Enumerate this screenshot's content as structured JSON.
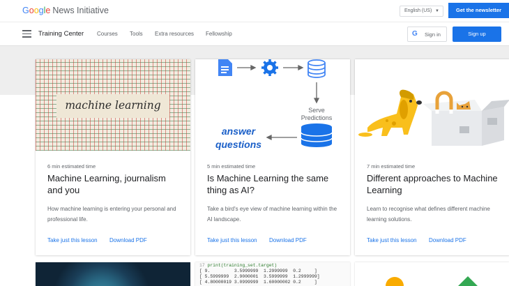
{
  "header": {
    "logo_google": "Google",
    "logo_rest": "News Initiative",
    "language": "English (US)",
    "newsletter_button": "Get the newsletter"
  },
  "nav": {
    "title": "Training Center",
    "links": [
      "Courses",
      "Tools",
      "Extra resources",
      "Fellowship"
    ],
    "signin": "Sign in",
    "signup": "Sign up"
  },
  "cards": [
    {
      "image_text": "machine learning",
      "time": "6 min estimated time",
      "title": "Machine Learning, journalism and you",
      "description": "How machine learning is entering your personal and professional life.",
      "link_lesson": "Take just this lesson",
      "link_pdf": "Download PDF"
    },
    {
      "image_serve": "Serve",
      "image_predictions": "Predictions",
      "image_answer": "answer",
      "image_questions": "questions",
      "time": "5 min estimated time",
      "title": "Is Machine Learning the same thing as AI?",
      "description": "Take a bird's eye view of machine learning within the AI landscape.",
      "link_lesson": "Take just this lesson",
      "link_pdf": "Download PDF"
    },
    {
      "time": "7 min estimated time",
      "title": "Different approaches to Machine Learning",
      "description": "Learn to recognise what defines different machine learning solutions.",
      "link_lesson": "Take just this lesson",
      "link_pdf": "Download PDF"
    }
  ],
  "code_preview": {
    "line_no": "17",
    "command": "print(training_set.target)",
    "rows": [
      "[ 9.         3.5999999  1.2999999  0.2     ]",
      "[ 5.5999999  2.9000001  3.5999999  1.2999999]",
      "[ 4.80000019 3.0999999  1.60000002 0.2     ]"
    ]
  },
  "colors": {
    "primary": "#1a73e8",
    "google_blue": "#4285f4",
    "yellow_dog": "#f9bf1c",
    "diagram_text": "#1a5fc8"
  }
}
